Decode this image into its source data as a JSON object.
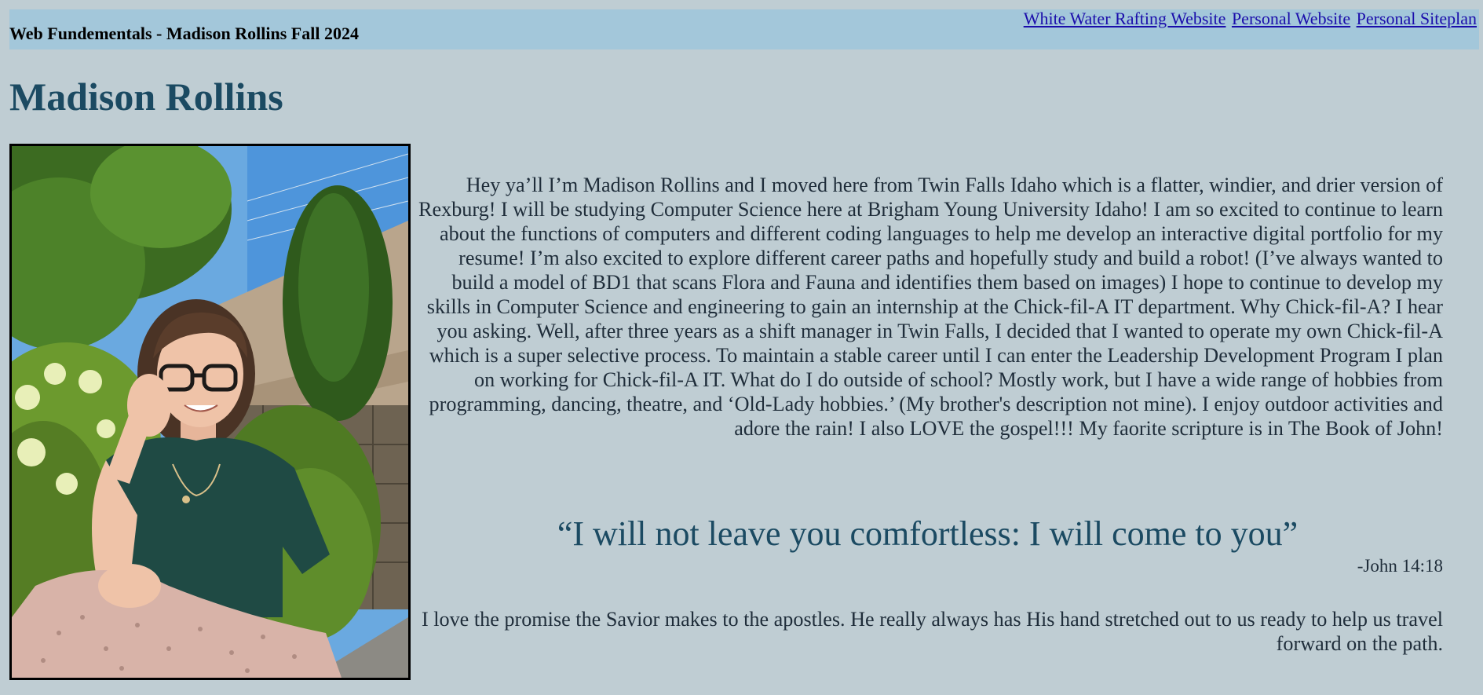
{
  "header": {
    "site_title": "Web Fundementals - Madison Rollins Fall 2024",
    "nav": [
      {
        "label": "White Water Rafting Website"
      },
      {
        "label": "Personal Website"
      },
      {
        "label": "Personal Siteplan"
      }
    ]
  },
  "main": {
    "heading": "Madison Rollins",
    "photo_alt": "Madison Rollins",
    "bio": "Hey ya’ll I’m Madison Rollins and I moved here from Twin Falls Idaho which is a flatter, windier, and drier version of Rexburg! I will be studying Computer Science here at Brigham Young University Idaho! I am so excited to continue to learn about the functions of computers and different coding languages to help me develop an interactive digital portfolio for my resume! I’m also excited to explore different career paths and hopefully study and build a robot! (I’ve always wanted to build a model of BD1 that scans Flora and Fauna and identifies them based on images) I hope to continue to develop my skills in Computer Science and engineering to gain an internship at the Chick-fil-A IT department. Why Chick-fil-A? I hear you asking. Well, after three years as a shift manager in Twin Falls, I decided that I wanted to operate my own Chick-fil-A which is a super selective process. To maintain a stable career until I can enter the Leadership Development Program I plan on working for Chick-fil-A IT. What do I do outside of school? Mostly work, but I have a wide range of hobbies from programming, dancing, theatre, and ‘Old-Lady hobbies.’ (My brother's description not mine). I enjoy outdoor activities and adore the rain! I also LOVE the gospel!!! My faorite scripture is in The Book of John!",
    "quote": "“I will not leave you comfortless: I will come to you”",
    "quote_citation": "-John 14:18",
    "reflection": "I love the promise the Savior makes to the apostles. He really always has His hand stretched out to us ready to help us travel forward on the path."
  }
}
